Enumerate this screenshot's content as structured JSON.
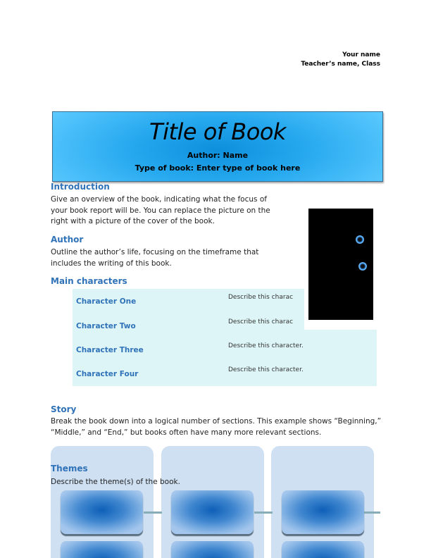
{
  "header": {
    "your_name": "Your name",
    "teacher_class": "Teacher’s name, Class"
  },
  "title_banner": {
    "title": "Title of Book",
    "author": "Author: Name",
    "type_of_book": "Type of book: Enter type of book here",
    "gradient_colors": [
      "#0d8fdc",
      "#27a9ef",
      "#5ccaff"
    ]
  },
  "introduction": {
    "heading": "Introduction",
    "lines": [
      "Give an overview of the book, indicating what the focus of",
      "your book report will be. You can replace the picture on the",
      "right with a picture of the cover of the book."
    ]
  },
  "author": {
    "heading": "Author",
    "lines": [
      "Outline the author’s life, focusing on the timeframe that",
      "includes the writing of this book."
    ]
  },
  "main_characters": {
    "heading": "Main characters",
    "characters": [
      {
        "name": "Character One",
        "description": "Describe this charac"
      },
      {
        "name": "Character Two",
        "description": "Describe this charac"
      },
      {
        "name": "Character Three",
        "description": "Describe this character."
      },
      {
        "name": "Character Four",
        "description": "Describe this character."
      }
    ]
  },
  "story": {
    "heading": "Story",
    "lines": [
      "Break the book down into a logical number of sections. This example shows “Beginning,”",
      "“Middle,” and “End,” but books often have many more relevant sections."
    ]
  },
  "themes": {
    "heading": "Themes",
    "text": "Describe the theme(s) of the book."
  },
  "colors": {
    "heading_blue": "#2f72b8",
    "table_bg": "#def5f8",
    "story_column_bg": "#cfe0f2"
  }
}
